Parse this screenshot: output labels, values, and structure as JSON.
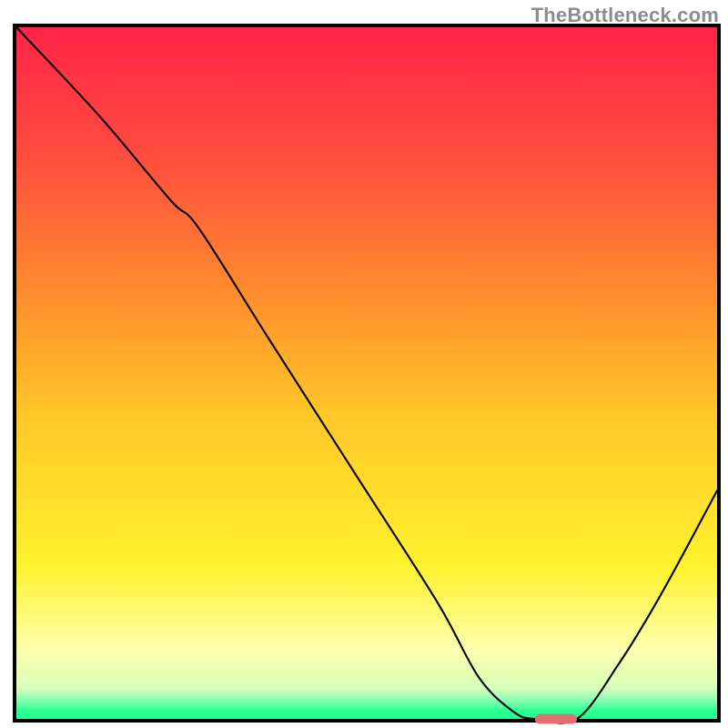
{
  "watermark": {
    "text": "TheBottleneck.com"
  },
  "chart_data": {
    "type": "line",
    "title": "",
    "xlabel": "",
    "ylabel": "",
    "xlim": [
      0,
      100
    ],
    "ylim": [
      0,
      100
    ],
    "grid": false,
    "legend": false,
    "axes_visible": false,
    "background": {
      "description": "continuous vertical gradient from red (top) through orange, yellow, pale yellow, to thin green strip at bottom",
      "stops": [
        {
          "pos": 0,
          "color": "#ff2448"
        },
        {
          "pos": 0.18,
          "color": "#ff4b3e"
        },
        {
          "pos": 0.38,
          "color": "#ff8b2e"
        },
        {
          "pos": 0.56,
          "color": "#ffc728"
        },
        {
          "pos": 0.78,
          "color": "#fff22e"
        },
        {
          "pos": 0.9,
          "color": "#fdffae"
        },
        {
          "pos": 0.955,
          "color": "#d8ffb9"
        },
        {
          "pos": 0.972,
          "color": "#8dffb4"
        },
        {
          "pos": 0.988,
          "color": "#2dff94"
        },
        {
          "pos": 1.0,
          "color": "#1cff8e"
        }
      ]
    },
    "series": [
      {
        "name": "bottleneck-curve",
        "color": "#000000",
        "strokeWidth": 2.1,
        "x": [
          0,
          12,
          22,
          26,
          36,
          48,
          60,
          66,
          71,
          74,
          80,
          86,
          92,
          100
        ],
        "values": [
          100,
          87,
          75,
          71,
          55,
          36,
          17,
          6,
          1,
          0,
          0,
          8,
          18,
          33
        ],
        "_note": "values are percentage height from bottom; 0 = bottom (green), 100 = top (red). Curve has a slope inflection ~x=25, nearly straight down to trough ~x=74–80, then rises."
      }
    ],
    "marker": {
      "name": "trough-marker",
      "shape": "pill",
      "color": "#e27070",
      "x": 77,
      "y": 0,
      "width": 6,
      "height": 1.4
    }
  }
}
